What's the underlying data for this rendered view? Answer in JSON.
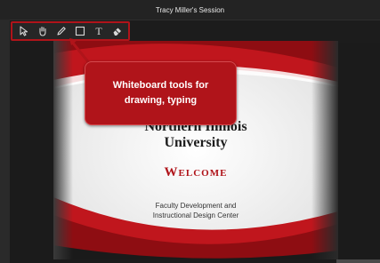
{
  "window": {
    "title": "Tracy Miller's Session"
  },
  "toolbar": {
    "tools": [
      {
        "name": "select-tool",
        "icon": "pointer-icon"
      },
      {
        "name": "pan-tool",
        "icon": "hand-icon"
      },
      {
        "name": "pencil-tool",
        "icon": "pencil-icon"
      },
      {
        "name": "shape-tool",
        "icon": "rectangle-icon"
      },
      {
        "name": "text-tool",
        "icon": "text-icon",
        "label": "T"
      },
      {
        "name": "eraser-tool",
        "icon": "eraser-icon"
      }
    ],
    "highlight_color": "#b0141a"
  },
  "callout": {
    "text": "Whiteboard tools for drawing, typing",
    "color": "#b0141a"
  },
  "slide": {
    "university_line1": "Northern Illinois",
    "university_line2": "University",
    "welcome": "Welcome",
    "subtitle_line1": "Faculty Development and",
    "subtitle_line2": "Instructional Design Center",
    "accent_color": "#b0141a"
  }
}
